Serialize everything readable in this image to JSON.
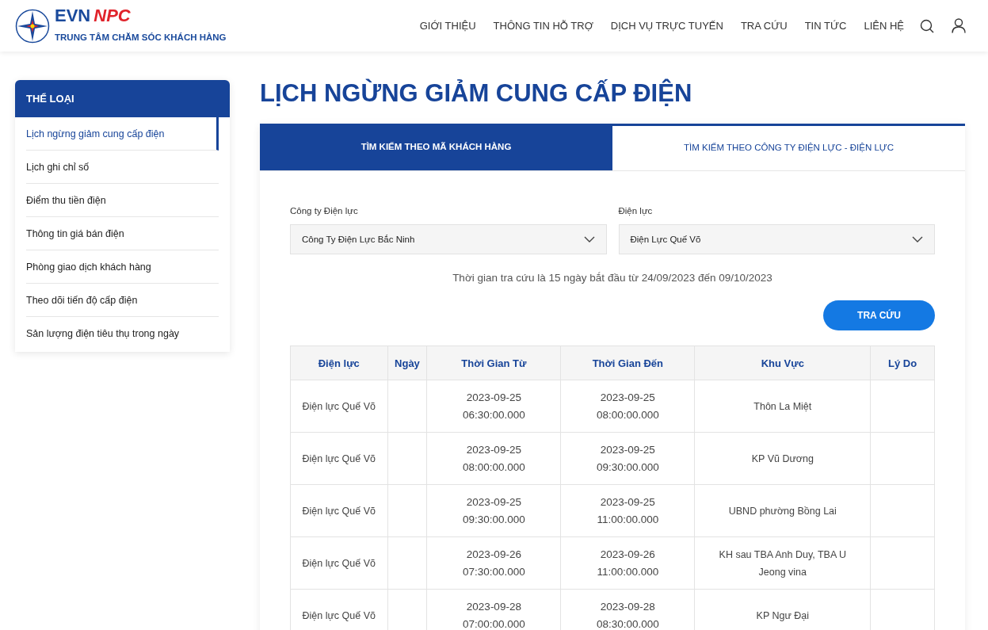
{
  "header": {
    "brand": {
      "part_1": "EVN",
      "part_2": "NPC",
      "subtitle": "TRUNG TÂM CHĂM SÓC KHÁCH HÀNG"
    },
    "nav": [
      "GIỚI THIỆU",
      "THÔNG TIN HỖ TRỢ",
      "DỊCH VỤ TRỰC TUYẾN",
      "TRA CỨU",
      "TIN TỨC",
      "LIÊN HỆ"
    ]
  },
  "sidebar": {
    "title": "THỂ LOẠI",
    "items": [
      {
        "label": "Lịch ngừng giảm cung cấp điện",
        "selected": true
      },
      {
        "label": "Lịch ghi chỉ số",
        "selected": false
      },
      {
        "label": "Điểm thu tiền điện",
        "selected": false
      },
      {
        "label": "Thông tin giá bán điện",
        "selected": false
      },
      {
        "label": "Phòng giao dịch khách hàng",
        "selected": false
      },
      {
        "label": "Theo dõi tiến độ cấp điện",
        "selected": false
      },
      {
        "label": "Sản lượng điện tiêu thụ trong ngày",
        "selected": false
      }
    ]
  },
  "page_title": "LỊCH NGỪNG GIẢM CUNG CẤP ĐIỆN",
  "tabs": [
    {
      "label": "TÌM KIẾM THEO MÃ KHÁCH HÀNG",
      "selected": true
    },
    {
      "label": "TÌM KIẾM THEO CÔNG TY ĐIỆN LỰC - ĐIỆN LỰC",
      "selected": false
    }
  ],
  "form": {
    "fields": [
      {
        "label": "Công ty Điện lực",
        "value": "Công Ty Điện Lực Bắc Ninh"
      },
      {
        "label": "Điện lực",
        "value": "Điện Lực Quế Võ"
      }
    ],
    "note": "Thời gian tra cứu là 15 ngày bắt đầu từ 24/09/2023 đến 09/10/2023",
    "button": "TRA CỨU"
  },
  "table": {
    "columns": [
      "Điện lực",
      "Ngày",
      "Thời Gian Từ",
      "Thời Gian Đến",
      "Khu Vực",
      "Lý Do"
    ],
    "rows": [
      [
        "Điện lực Quế Võ",
        "",
        "2023-09-25 06:30:00.000",
        "2023-09-25 08:00:00.000",
        "Thôn La Miệt",
        ""
      ],
      [
        "Điện lực Quế Võ",
        "",
        "2023-09-25 08:00:00.000",
        "2023-09-25 09:30:00.000",
        "KP Vũ Dương",
        ""
      ],
      [
        "Điện lực Quế Võ",
        "",
        "2023-09-25 09:30:00.000",
        "2023-09-25 11:00:00.000",
        "UBND phường Bồng Lai",
        ""
      ],
      [
        "Điện lực Quế Võ",
        "",
        "2023-09-26 07:30:00.000",
        "2023-09-26 11:00:00.000",
        "KH sau TBA Anh Duy, TBA U Jeong vina",
        ""
      ],
      [
        "Điện lực Quế Võ",
        "",
        "2023-09-28 07:00:00.000",
        "2023-09-28 08:30:00.000",
        "KP Ngư Đại",
        ""
      ]
    ]
  }
}
